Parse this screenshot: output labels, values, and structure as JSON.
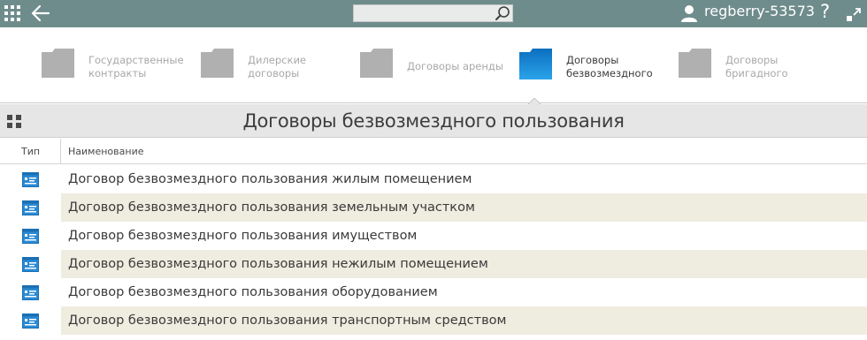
{
  "topbar": {
    "username": "regberry-53573",
    "help_label": "?",
    "search": {
      "value": "",
      "placeholder": ""
    }
  },
  "folders": [
    {
      "label": "Государственные контракты",
      "line1": "Государственные",
      "line2": "контракты",
      "active": false
    },
    {
      "label": "Дилерские договоры",
      "line1": "Дилерские",
      "line2": "договоры",
      "active": false
    },
    {
      "label": "Договоры аренды",
      "line1": "Договоры аренды",
      "line2": "",
      "active": false
    },
    {
      "label": "Договоры безвозмездного",
      "line1": "Договоры",
      "line2": "безвозмездного",
      "active": true
    },
    {
      "label": "Договоры бригадного",
      "line1": "Договоры",
      "line2": "бригадного",
      "active": false
    }
  ],
  "header": {
    "title": "Договоры безвозмездного пользования"
  },
  "table": {
    "columns": [
      "Тип",
      "Наименование"
    ],
    "rows": [
      "Договор безвозмездного пользования жилым помещением",
      "Договор безвозмездного пользования земельным участком",
      "Договор безвозмездного пользования имуществом",
      "Договор безвозмездного пользования нежилым помещением",
      "Договор безвозмездного пользования оборудованием",
      "Договор безвозмездного пользования транспортным средством"
    ]
  },
  "colors": {
    "topbar": "#6f8c8c",
    "folder_inactive": "#b0b0b0",
    "folder_active": "#1e8fd8",
    "row_alt": "#efece0",
    "doc_icon": "#2a8ad4"
  },
  "icons": [
    "apps-grid-icon",
    "back-arrow-icon",
    "search-icon",
    "user-icon",
    "help-icon",
    "expand-icon",
    "folder-icon",
    "grid-view-icon",
    "document-icon"
  ]
}
